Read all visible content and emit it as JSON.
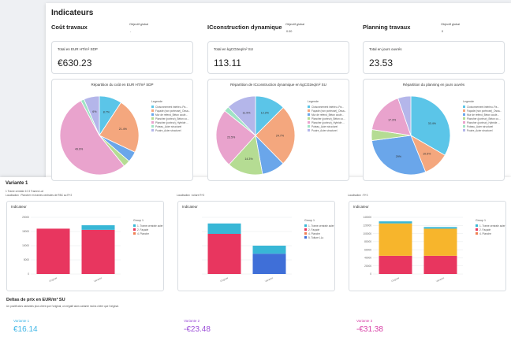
{
  "header": {
    "title": "Indicateurs"
  },
  "sections": [
    {
      "title": "Coût travaux",
      "objective_label": "Objectif global",
      "objective_value": "-",
      "kpi_label": "Total en EUR HT/m² SDP",
      "kpi_value": "€630.23",
      "chart_title": "Répartition du coût en EUR HT/m² SDP"
    },
    {
      "title": "ICconstruction dynamique",
      "objective_label": "Objectif global",
      "objective_value": "0.00",
      "kpi_label": "Total en kgCO2eq/m² SU",
      "kpi_value": "113.11",
      "chart_title": "Répartition de ICconstruction dynamique en kgCO2eq/m² SU"
    },
    {
      "title": "Planning travaux",
      "objective_label": "Objectif global",
      "objective_value": "0",
      "kpi_label": "Total en jours ouvrés",
      "kpi_value": "23.53",
      "chart_title": "Répartition du planning en jours ouvrés"
    }
  ],
  "pie_legend": {
    "title": "Legende",
    "items": [
      "Cloisonnement intérieu..Pa...",
      "Façade (non porteuse)_Ossa...",
      "Mur de refend_Béton coulé...",
      "Plancher (porteur)_Béton co...",
      "Plancher (porteur)_Hybride ...",
      "Poteau_Acier structurel",
      "Poutre_Acier structurel"
    ],
    "colors": [
      "#5bc5e8",
      "#f4a77e",
      "#6aa6ea",
      "#b5dc93",
      "#e9a3cd",
      "#9fe3c4",
      "#b4b6ea"
    ]
  },
  "pies": [
    {
      "values": [
        8.7,
        21.4,
        4.1,
        2.6,
        49.9,
        1.3,
        6.0
      ],
      "labels": [
        "8.7%",
        "21.4%",
        "",
        "",
        "49.9%",
        "",
        "6%"
      ]
    },
    {
      "values": [
        12.2,
        24.7,
        9.3,
        14.3,
        23.5,
        2.1,
        11.9
      ],
      "labels": [
        "12.2%",
        "24.7%",
        "",
        "14.3%",
        "23.5%",
        "",
        "11.9%"
      ]
    },
    {
      "values": [
        33.4,
        10.5,
        29.0,
        4.5,
        17.3,
        0,
        5.3
      ],
      "labels": [
        "33.4%",
        "10.5%",
        "29%",
        "",
        "17.3%",
        "",
        ""
      ]
    }
  ],
  "variant": {
    "title": "Variante 1",
    "subtitle": "1 Trame centrale 10 3 Trames Lat",
    "localisations": [
      "Localisation : Plancher en trames centrales de RBC au R+2",
      "Localisation : toiture R+3",
      "Localisation : R+3"
    ]
  },
  "indicator_cards": [
    {
      "title": "Indicateur",
      "legend_title": "Group 1",
      "legend": [
        "1. Trame centrale acier",
        "2. Façade",
        "4. Planche"
      ],
      "colors": [
        "#38b7d6",
        "#e8365f",
        "#f07f52"
      ],
      "ytick_labels": [
        "20000",
        "15000",
        "10000",
        "5000",
        "0"
      ],
      "ymax": 25000,
      "categories": [
        "Original",
        "Variante"
      ],
      "stacks": [
        [
          {
            "v": 20000,
            "c": "#e8365f"
          }
        ],
        [
          {
            "v": 19500,
            "c": "#e8365f"
          },
          {
            "v": 2000,
            "c": "#38b7d6"
          }
        ]
      ]
    },
    {
      "title": "Indicateur",
      "legend_title": "Group 1",
      "legend": [
        "1. Trame centrale acier",
        "2. Façade",
        "4. Planche",
        "5. Toiture LLu"
      ],
      "colors": [
        "#38b7d6",
        "#e8365f",
        "#f07f52",
        "#3f6fd8"
      ],
      "ytick_labels": [
        "",
        "",
        "",
        "",
        ""
      ],
      "ymax": 12,
      "categories": [
        "Original",
        "Variante"
      ],
      "stacks": [
        [
          {
            "v": 8.5,
            "c": "#e8365f"
          },
          {
            "v": 2.2,
            "c": "#38b7d6"
          }
        ],
        [
          {
            "v": 4.3,
            "c": "#3f6fd8"
          },
          {
            "v": 1.7,
            "c": "#38b7d6"
          }
        ]
      ]
    },
    {
      "title": "Indicateur",
      "legend_title": "Group 1",
      "legend": [
        "1. Trame centrale acier",
        "2. Façade",
        "4. Planche"
      ],
      "colors": [
        "#38b7d6",
        "#e8365f",
        "#f07f52"
      ],
      "ytick_labels": [
        "140000",
        "120000",
        "100000",
        "80000",
        "60000",
        "40000",
        "20000",
        "0"
      ],
      "ymax": 140000,
      "categories": [
        "Original",
        "Variante"
      ],
      "stacks": [
        [
          {
            "v": 45000,
            "c": "#e8365f"
          },
          {
            "v": 80000,
            "c": "#f7b52c"
          },
          {
            "v": 5000,
            "c": "#38b7d6"
          }
        ],
        [
          {
            "v": 45000,
            "c": "#e8365f"
          },
          {
            "v": 67000,
            "c": "#f7b52c"
          },
          {
            "v": 4000,
            "c": "#38b7d6"
          }
        ]
      ]
    }
  ],
  "deltas": {
    "title": "Deltas de prix en EUR/m² SU",
    "subtitle": "Un positif alors variantes plus chère que l'original, un négatif alors variante moins chère que l'original.",
    "items": [
      {
        "label": "Variante 1",
        "value": "€16.14",
        "color": "#3fb6e6"
      },
      {
        "label": "Variante 2",
        "value": "-€23.48",
        "color": "#9c4fd8"
      },
      {
        "label": "Variante 3",
        "value": "-€31.38",
        "color": "#d83fa6"
      }
    ]
  }
}
